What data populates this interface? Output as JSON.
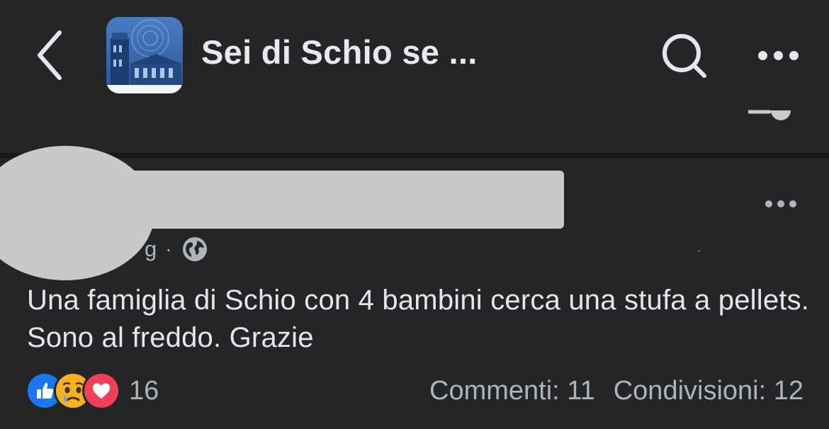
{
  "header": {
    "title": "Sei di Schio se ...",
    "back_icon": "chevron-left-icon",
    "search_icon": "search-icon",
    "more_icon": "more-horizontal-icon"
  },
  "post": {
    "time": "g",
    "meta_separator": "·",
    "privacy_icon": "globe-icon",
    "text": "Una famiglia di Schio con 4 bambini cerca una stufa a pellets. Sono al freddo. Grazie",
    "reactions": {
      "icons": [
        "like-icon",
        "sad-icon",
        "love-icon"
      ],
      "count": "16"
    },
    "comments_label": "Commenti: 11",
    "shares_label": "Condivisioni: 12"
  },
  "colors": {
    "background": "#242527",
    "divider": "#18191a",
    "text_primary": "#e4e6eb",
    "text_secondary": "#b0b3b8",
    "redaction": "#c9c9c9",
    "like_blue": "#1877f2",
    "love_red": "#f33e58",
    "sad_yellow": "#f7b125"
  }
}
